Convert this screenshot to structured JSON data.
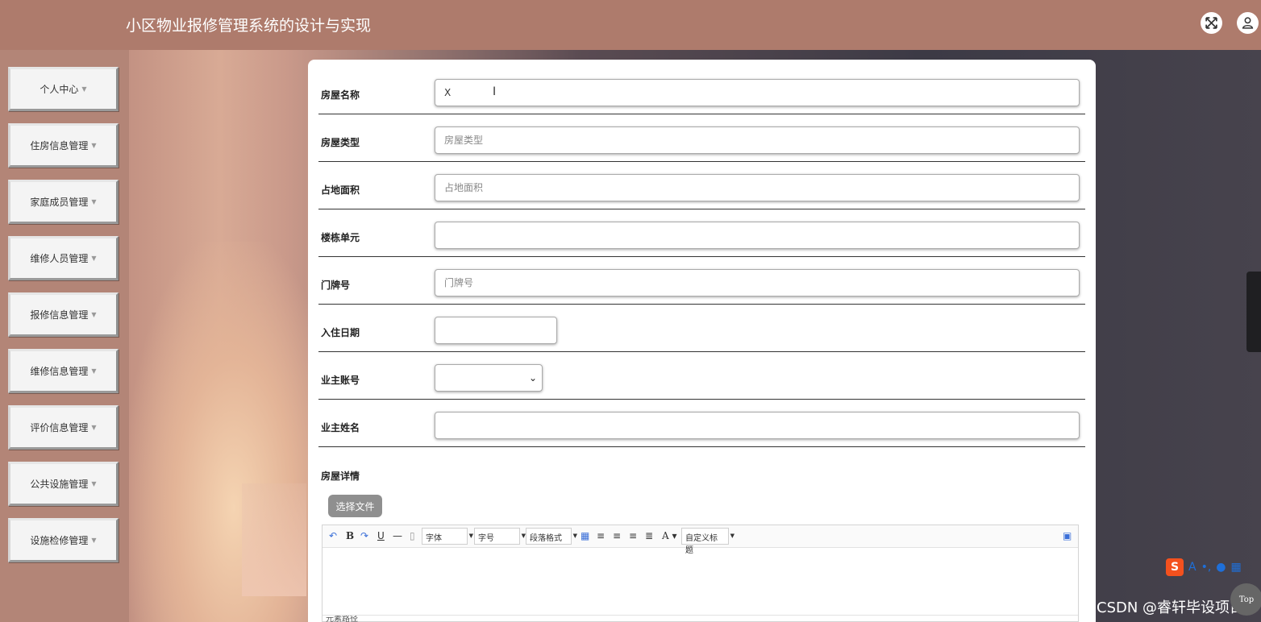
{
  "header": {
    "title": "小区物业报修管理系统的设计与实现"
  },
  "sidebar": {
    "items": [
      {
        "label": "个人中心"
      },
      {
        "label": "住房信息管理"
      },
      {
        "label": "家庭成员管理"
      },
      {
        "label": "维修人员管理"
      },
      {
        "label": "报修信息管理"
      },
      {
        "label": "维修信息管理"
      },
      {
        "label": "评价信息管理"
      },
      {
        "label": "公共设施管理"
      },
      {
        "label": "设施检修管理"
      }
    ]
  },
  "form": {
    "house_name": {
      "label": "房屋名称",
      "value": "X",
      "placeholder": ""
    },
    "house_type": {
      "label": "房屋类型",
      "value": "",
      "placeholder": "房屋类型"
    },
    "area": {
      "label": "占地面积",
      "value": "",
      "placeholder": "占地面积"
    },
    "building_unit": {
      "label": "楼栋单元",
      "value": "",
      "placeholder": ""
    },
    "door_number": {
      "label": "门牌号",
      "value": "",
      "placeholder": "门牌号"
    },
    "move_in_date": {
      "label": "入住日期",
      "value": ""
    },
    "owner_account": {
      "label": "业主账号",
      "value": ""
    },
    "owner_name": {
      "label": "业主姓名",
      "value": "",
      "placeholder": ""
    },
    "house_detail": {
      "label": "房屋详情"
    },
    "file_button": "选择文件"
  },
  "editor": {
    "font_family": "字体",
    "font_size": "字号",
    "paragraph": "段落格式",
    "custom_title": "自定义标题",
    "footer": "元素路径"
  },
  "overlay": {
    "ime_logo": "S",
    "watermark": "CSDN @睿轩毕设项目",
    "top_button": "Top"
  }
}
